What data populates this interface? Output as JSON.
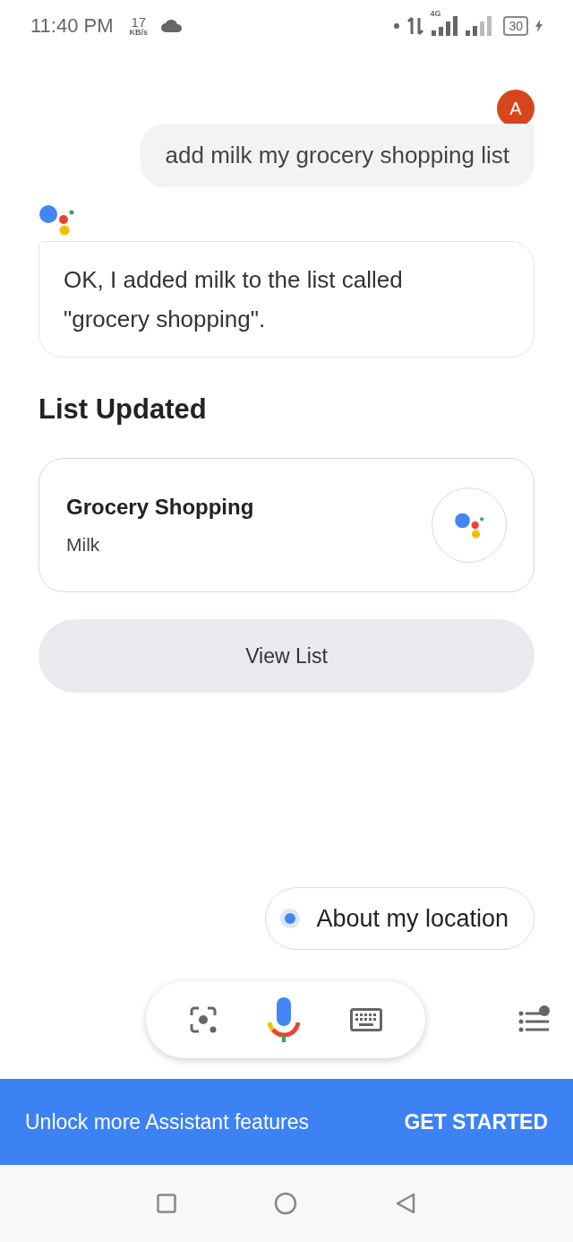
{
  "status_bar": {
    "time": "11:40 PM",
    "speed": "17",
    "speed_unit": "KB/s",
    "network": "4G",
    "battery": "30"
  },
  "user_avatar": {
    "letter": "A"
  },
  "user_message": "add milk my grocery shopping list",
  "assistant_reply": "OK, I added milk to the list called \"grocery shopping\".",
  "section_title": "List Updated",
  "list_card": {
    "title": "Grocery Shopping",
    "item": "Milk"
  },
  "view_button": "View List",
  "suggestion_chip": "About my location",
  "banner": {
    "text": "Unlock more Assistant features",
    "action": "GET STARTED"
  }
}
